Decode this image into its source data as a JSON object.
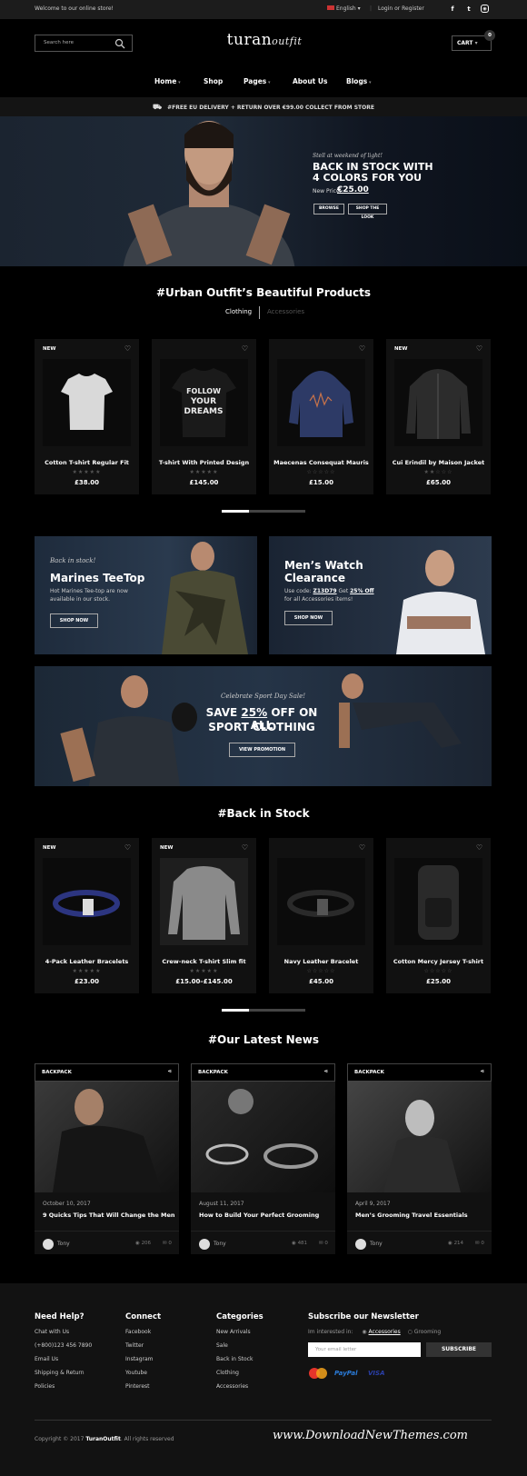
{
  "topbar": {
    "welcome": "Welcome to our online store!",
    "language": "English",
    "login": "Login or Register"
  },
  "header": {
    "search_placeholder": "Search here",
    "logo_main": "turan",
    "logo_script": "outfit",
    "cart_label": "CART",
    "cart_count": "0"
  },
  "nav": [
    "Home",
    "Shop",
    "Pages",
    "About Us",
    "Blogs"
  ],
  "promo_bar": "#FREE EU DELIVERY + RETURN OVER €99.00 COLLECT FROM STORE",
  "hero": {
    "script": "Stell at weekend of light!",
    "title_line1": "BACK IN STOCK WITH",
    "title_line2": "4 COLORS FOR YOU",
    "price_label": "New Price:",
    "price": "€25.00",
    "btn_browse": "BROWSE",
    "btn_look": "SHOP THE LOOK"
  },
  "products_section": {
    "title": "#Urban Outfit’s Beautiful Products",
    "tab_active": "Clothing",
    "tab_inactive": "Accessories",
    "items": [
      {
        "badge": "NEW",
        "name": "Cotton T-shirt Regular Fit",
        "price": "£38.00",
        "rating": 5
      },
      {
        "badge": "",
        "name": "T-shirt With Printed Design",
        "price": "£145.00",
        "rating": 5
      },
      {
        "badge": "",
        "name": "Maecenas Consequat Mauris",
        "price": "£15.00",
        "rating": 0
      },
      {
        "badge": "NEW",
        "name": "Cui Erindil by Maison Jacket",
        "price": "£65.00",
        "rating": 2
      }
    ],
    "tee_print": [
      "FOLLOW",
      "YOUR",
      "DREAMS"
    ]
  },
  "banner_left": {
    "script": "Back in stock!",
    "title": "Marines TeeTop",
    "desc1": "Hot Marines Tee-top are now",
    "desc2": "available in our stock.",
    "btn": "SHOP NOW"
  },
  "banner_right": {
    "title_line1": "Men’s Watch",
    "title_line2": "Clearance",
    "code_prefix": "Use code:",
    "code": "Z13D79",
    "code_mid": "Get",
    "discount": "25% Off",
    "desc": "for all Accessories items!",
    "btn": "SHOP NOW"
  },
  "banner_wide": {
    "script": "Celebrate Sport Day Sale!",
    "title_pre": "SAVE ",
    "title_pct": "25%",
    "title_post": " OFF ON ALL",
    "title_line2": "SPORT CLOTHING",
    "btn": "VIEW PROMOTION"
  },
  "stock_section": {
    "title": "#Back in Stock",
    "items": [
      {
        "badge": "NEW",
        "name": "4-Pack Leather Bracelets",
        "price": "£23.00",
        "rating": 0
      },
      {
        "badge": "NEW",
        "name": "Crew-neck T-shirt Slim fit",
        "price": "£15.00–£145.00",
        "rating": 0
      },
      {
        "badge": "",
        "name": "Navy Leather Bracelet",
        "price": "£45.00",
        "rating": 0
      },
      {
        "badge": "",
        "name": "Cotton Mercy Jersey T-shirt",
        "price": "£25.00",
        "rating": 0
      }
    ]
  },
  "news_section": {
    "title": "#Our Latest News",
    "items": [
      {
        "tag": "BACKPACK",
        "date": "October 10, 2017",
        "title": "9 Quicks Tips That Will Change the Men",
        "author": "Tony",
        "views": "206",
        "comments": "0"
      },
      {
        "tag": "BACKPACK",
        "date": "August 11, 2017",
        "title": "How to Build Your Perfect Grooming",
        "author": "Tony",
        "views": "481",
        "comments": "0"
      },
      {
        "tag": "BACKPACK",
        "date": "April 9, 2017",
        "title": "Men’s Grooming Travel Essentials",
        "author": "Tony",
        "views": "214",
        "comments": "0"
      }
    ]
  },
  "footer": {
    "help": {
      "title": "Need Help?",
      "links": [
        "Chat with Us",
        "(+800)123 456 7890",
        "Email Us",
        "Shipping & Return",
        "Policies"
      ]
    },
    "connect": {
      "title": "Connect",
      "links": [
        "Facebook",
        "Twitter",
        "Instagram",
        "Youtube",
        "Pinterest"
      ]
    },
    "categories": {
      "title": "Categories",
      "links": [
        "New Arrivals",
        "Sale",
        "Back in Stock",
        "Clothing",
        "Accessories"
      ]
    },
    "newsletter": {
      "title": "Subscribe our Newsletter",
      "interest_label": "Im interested in:",
      "opt1": "Accessories",
      "opt2": "Grooming",
      "placeholder": "Your email letter",
      "btn": "SUBSCRIBE"
    },
    "payments": [
      "mastercard-icon",
      "PayPal",
      "VISA"
    ],
    "copyright_pre": "Copyright © 2017 ",
    "copyright_brand": "TuranOutfit",
    "copyright_post": ". All rights reserved",
    "watermark": "www.DownloadNewThemes.com"
  },
  "colors": {
    "bg": "#000000",
    "card": "#111111",
    "footer": "#121212",
    "accent": "#ffffff"
  }
}
